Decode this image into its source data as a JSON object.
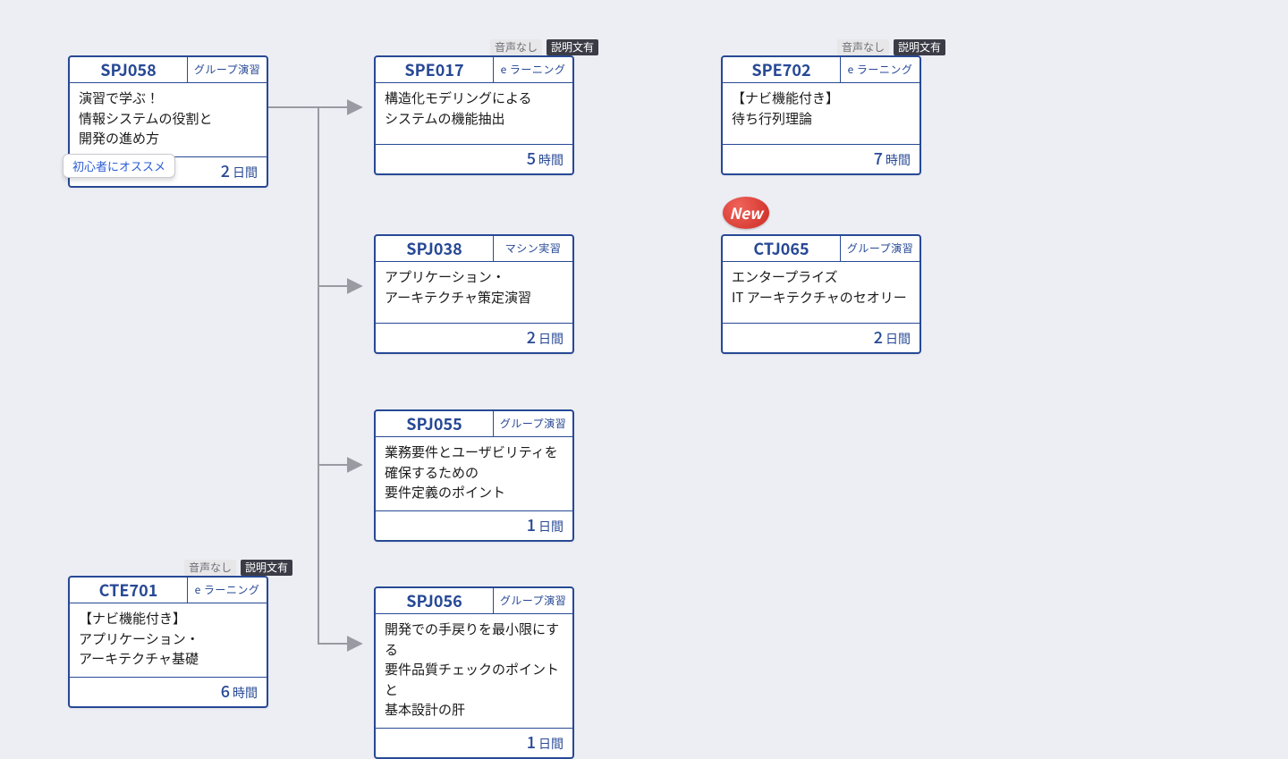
{
  "badge_audio_off": "音声なし",
  "badge_desc_on": "説明文有",
  "reco_text": "初心者にオススメ",
  "new_text": "New",
  "cards": {
    "c0": {
      "code": "SPJ058",
      "tag": "グループ演習",
      "body": "演習で学ぶ！\n情報システムの役割と\n開発の進め方",
      "dur_num": "2",
      "dur_unit": "日間"
    },
    "c1": {
      "code": "SPE017",
      "tag": "e ラーニング",
      "body": "構造化モデリングによる\nシステムの機能抽出",
      "dur_num": "5",
      "dur_unit": "時間"
    },
    "c2": {
      "code": "SPE702",
      "tag": "e ラーニング",
      "body": "【ナビ機能付き】\n待ち行列理論",
      "dur_num": "7",
      "dur_unit": "時間"
    },
    "c3": {
      "code": "SPJ038",
      "tag": "マシン実習",
      "body": "アプリケーション・\nアーキテクチャ策定演習",
      "dur_num": "2",
      "dur_unit": "日間"
    },
    "c4": {
      "code": "CTJ065",
      "tag": "グループ演習",
      "body": "エンタープライズ\nIT アーキテクチャのセオリー",
      "dur_num": "2",
      "dur_unit": "日間"
    },
    "c5": {
      "code": "SPJ055",
      "tag": "グループ演習",
      "body": "業務要件とユーザビリティを\n確保するための\n要件定義のポイント",
      "dur_num": "1",
      "dur_unit": "日間"
    },
    "c6": {
      "code": "SPJ056",
      "tag": "グループ演習",
      "body": "開発での手戻りを最小限にする\n要件品質チェックのポイントと\n基本設計の肝",
      "dur_num": "1",
      "dur_unit": "日間"
    },
    "c7": {
      "code": "CTE701",
      "tag": "e ラーニング",
      "body": "【ナビ機能付き】\nアプリケーション・\nアーキテクチャ基礎",
      "dur_num": "6",
      "dur_unit": "時間"
    }
  }
}
